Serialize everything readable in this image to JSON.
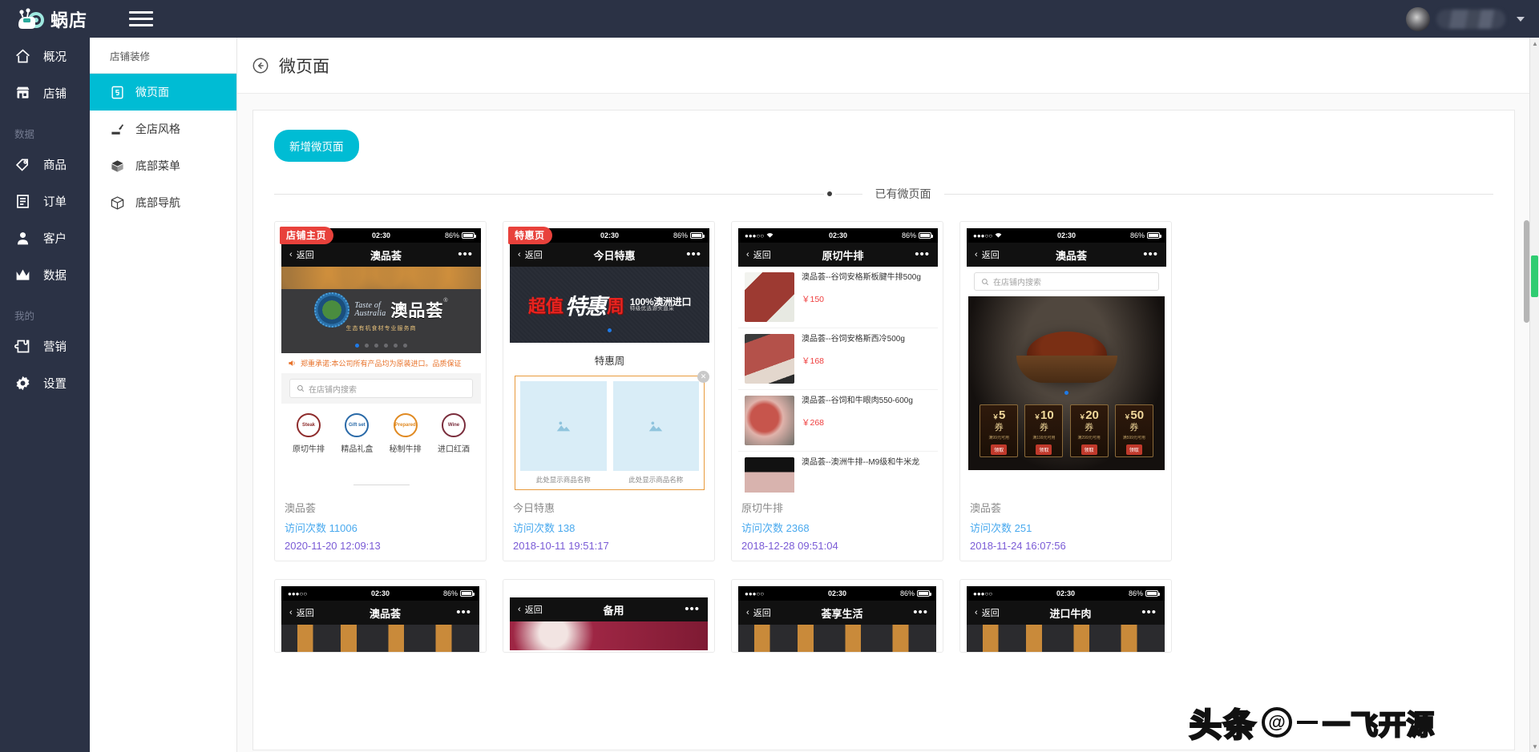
{
  "topbar": {
    "brand": "蜗店",
    "menu_icon": "hamburger-icon",
    "user_caret": "chevron-down-icon"
  },
  "leftnav": {
    "items": [
      {
        "label": "概况",
        "icon": "home-icon"
      },
      {
        "label": "店铺",
        "icon": "shop-icon"
      }
    ],
    "group_data": "数据",
    "data_items": [
      {
        "label": "商品",
        "icon": "tag-icon"
      },
      {
        "label": "订单",
        "icon": "document-icon"
      },
      {
        "label": "客户",
        "icon": "user-icon"
      },
      {
        "label": "数据",
        "icon": "chart-icon"
      }
    ],
    "group_mine": "我的",
    "mine_items": [
      {
        "label": "营销",
        "icon": "puzzle-icon"
      },
      {
        "label": "设置",
        "icon": "gear-icon"
      }
    ]
  },
  "subnav": {
    "title": "店铺装修",
    "items": [
      {
        "label": "微页面",
        "icon": "html5-icon",
        "active": true
      },
      {
        "label": "全店风格",
        "icon": "paint-icon",
        "active": false
      },
      {
        "label": "底部菜单",
        "icon": "box-icon",
        "active": false
      },
      {
        "label": "底部导航",
        "icon": "cube-icon",
        "active": false
      }
    ]
  },
  "page": {
    "title": "微页面",
    "back_icon": "back-arrow-circle-icon",
    "new_button": "新增微页面",
    "divider_label": "已有微页面"
  },
  "cards": [
    {
      "ribbon": "店铺主页",
      "status": {
        "time": "02:30",
        "battery": "86%",
        "signal": "●●●○○"
      },
      "nav": {
        "back": "返回",
        "title": "澳品荟",
        "more": "•••"
      },
      "banner": {
        "logo_line1": "Taste of",
        "logo_line2": "Australia",
        "logo_cn": "澳品荟",
        "logo_reg": "®",
        "logo_sub": "生态有机食材专业服务商"
      },
      "notice": "郑重承诺:本公司所有产品均为原装进口。品质保证",
      "search_placeholder": "在店铺内搜索",
      "categories": [
        {
          "label": "原切牛排",
          "seal": "Steak"
        },
        {
          "label": "精品礼盒",
          "seal": "Gift set"
        },
        {
          "label": "秘制牛排",
          "seal": "Prepared"
        },
        {
          "label": "进口红酒",
          "seal": "Wine"
        }
      ],
      "footer": {
        "name": "澳品荟",
        "visits_label": "访问次数",
        "visits": "11006",
        "date": "2020-11-20 12:09:13"
      }
    },
    {
      "ribbon": "特惠页",
      "status": {
        "time": "02:30",
        "battery": "86%",
        "signal": "●●●○○"
      },
      "nav": {
        "back": "返回",
        "title": "今日特惠",
        "more": "•••"
      },
      "banner": {
        "red1": "超值",
        "white": "特惠",
        "red2": "周",
        "side1": "100%澳洲进口",
        "side2": "特级优选源头直采"
      },
      "section_title": "特惠周",
      "placeholders": [
        {
          "caption": "此处显示商品名称"
        },
        {
          "caption": "此处显示商品名称"
        }
      ],
      "footer": {
        "name": "今日特惠",
        "visits_label": "访问次数",
        "visits": "138",
        "date": "2018-10-11 19:51:17"
      }
    },
    {
      "ribbon": "",
      "status": {
        "time": "02:30",
        "battery": "86%",
        "signal": "●●●○○"
      },
      "nav": {
        "back": "返回",
        "title": "原切牛排",
        "more": "•••"
      },
      "products": [
        {
          "name": "澳品荟--谷饲安格斯板腱牛排500g",
          "price": "￥150"
        },
        {
          "name": "澳品荟--谷饲安格斯西冷500g",
          "price": "￥168"
        },
        {
          "name": "澳品荟--谷饲和牛眼肉550-600g",
          "price": "￥268"
        },
        {
          "name": "澳品荟--澳洲牛排--M9级和牛米龙",
          "price": ""
        }
      ],
      "footer": {
        "name": "原切牛排",
        "visits_label": "访问次数",
        "visits": "2368",
        "date": "2018-12-28 09:51:04"
      }
    },
    {
      "ribbon": "",
      "status": {
        "time": "02:30",
        "battery": "86%",
        "signal": "●●●○○"
      },
      "nav": {
        "back": "返回",
        "title": "澳品荟",
        "more": "•••"
      },
      "search_placeholder": "在店铺内搜索",
      "coupons": [
        {
          "amount": "5",
          "unit": "￥",
          "label": "券",
          "cond": "满99元可用",
          "btn": "领取"
        },
        {
          "amount": "10",
          "unit": "￥",
          "label": "券",
          "cond": "满199元可用",
          "btn": "领取"
        },
        {
          "amount": "20",
          "unit": "￥",
          "label": "券",
          "cond": "满299元可用",
          "btn": "领取"
        },
        {
          "amount": "50",
          "unit": "￥",
          "label": "券",
          "cond": "满599元可用",
          "btn": "领取"
        }
      ],
      "footer": {
        "name": "澳品荟",
        "visits_label": "访问次数",
        "visits": "251",
        "date": "2018-11-24 16:07:56"
      }
    }
  ],
  "cards_row2": [
    {
      "status": {
        "time": "02:30",
        "battery": "86%"
      },
      "nav": {
        "back": "返回",
        "title": "澳品荟",
        "more": "•••"
      }
    },
    {
      "status": {
        "time": "",
        "battery": ""
      },
      "nav": {
        "back": "返回",
        "title": "备用",
        "more": "•••"
      }
    },
    {
      "status": {
        "time": "02:30",
        "battery": "86%"
      },
      "nav": {
        "back": "返回",
        "title": "荟享生活",
        "more": "•••"
      }
    },
    {
      "status": {
        "time": "02:30",
        "battery": "86%"
      },
      "nav": {
        "back": "返回",
        "title": "进口牛肉",
        "more": "•••"
      }
    }
  ],
  "watermark": {
    "logo": "头条",
    "at": "@",
    "name": "一飞开源"
  },
  "colors": {
    "accent": "#00bcd4",
    "navbg": "#2b3245",
    "ribbon": "#e8413b",
    "visits": "#49a9ee",
    "date": "#7a5bd6",
    "price": "#ef3f3f"
  }
}
